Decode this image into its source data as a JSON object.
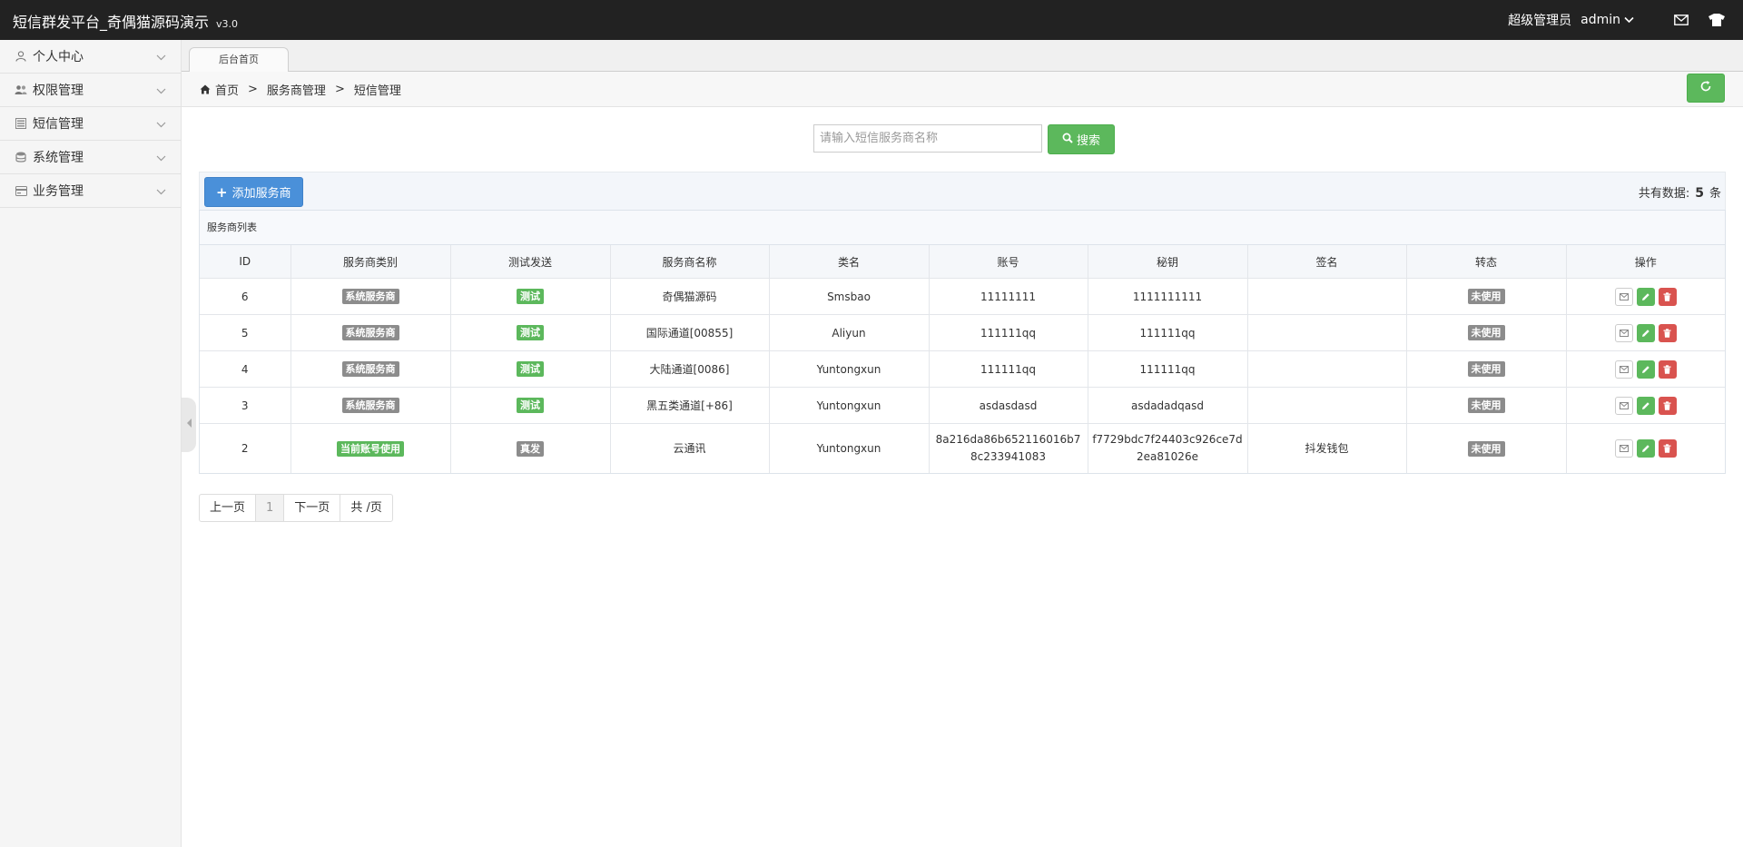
{
  "header": {
    "title": "短信群发平台_奇偶猫源码演示",
    "version": "v3.0",
    "role": "超级管理员",
    "username": "admin"
  },
  "sidebar": {
    "items": [
      {
        "label": "个人中心",
        "icon": "user-icon"
      },
      {
        "label": "权限管理",
        "icon": "users-icon"
      },
      {
        "label": "短信管理",
        "icon": "list-icon"
      },
      {
        "label": "系统管理",
        "icon": "database-icon"
      },
      {
        "label": "业务管理",
        "icon": "card-icon"
      }
    ]
  },
  "tabs": [
    {
      "label": "后台首页"
    }
  ],
  "breadcrumb": {
    "home": "首页",
    "level1": "服务商管理",
    "level2": "短信管理",
    "separator": ">"
  },
  "search": {
    "placeholder": "请输入短信服务商名称",
    "button": "搜索"
  },
  "toolbar": {
    "add_button": "添加服务商",
    "total_prefix": "共有数据:",
    "total_count": "5",
    "total_suffix": "条"
  },
  "table": {
    "title": "服务商列表",
    "columns": [
      "ID",
      "服务商类别",
      "测试发送",
      "服务商名称",
      "类名",
      "账号",
      "秘钥",
      "签名",
      "转态",
      "操作"
    ],
    "rows": [
      {
        "id": "6",
        "category": "系统服务商",
        "test": "测试",
        "name": "奇偶猫源码",
        "class": "Smsbao",
        "account": "11111111",
        "secret": "1111111111",
        "sign": "",
        "status": "未使用"
      },
      {
        "id": "5",
        "category": "系统服务商",
        "test": "测试",
        "name": "国际通道[00855]",
        "class": "Aliyun",
        "account": "111111qq",
        "secret": "111111qq",
        "sign": "",
        "status": "未使用"
      },
      {
        "id": "4",
        "category": "系统服务商",
        "test": "测试",
        "name": "大陆通道[0086]",
        "class": "Yuntongxun",
        "account": "111111qq",
        "secret": "111111qq",
        "sign": "",
        "status": "未使用"
      },
      {
        "id": "3",
        "category": "系统服务商",
        "test": "测试",
        "name": "黑五类通道[+86]",
        "class": "Yuntongxun",
        "account": "asdasdasd",
        "secret": "asdadadqasd",
        "sign": "",
        "status": "未使用"
      },
      {
        "id": "2",
        "category": "当前账号使用",
        "test": "真发",
        "name": "云通讯",
        "class": "Yuntongxun",
        "account": "8a216da86b652116016b78c233941083",
        "secret": "f7729bdc7f24403c926ce7d2ea81026e",
        "sign": "抖发钱包",
        "status": "未使用"
      }
    ]
  },
  "pagination": {
    "prev": "上一页",
    "current": "1",
    "next": "下一页",
    "total": "共 /页"
  },
  "colors": {
    "header_bg": "#222222",
    "success": "#5cb85c",
    "primary": "#4a90d9",
    "danger": "#d9534f",
    "badge_gray": "#8c8c8c"
  }
}
